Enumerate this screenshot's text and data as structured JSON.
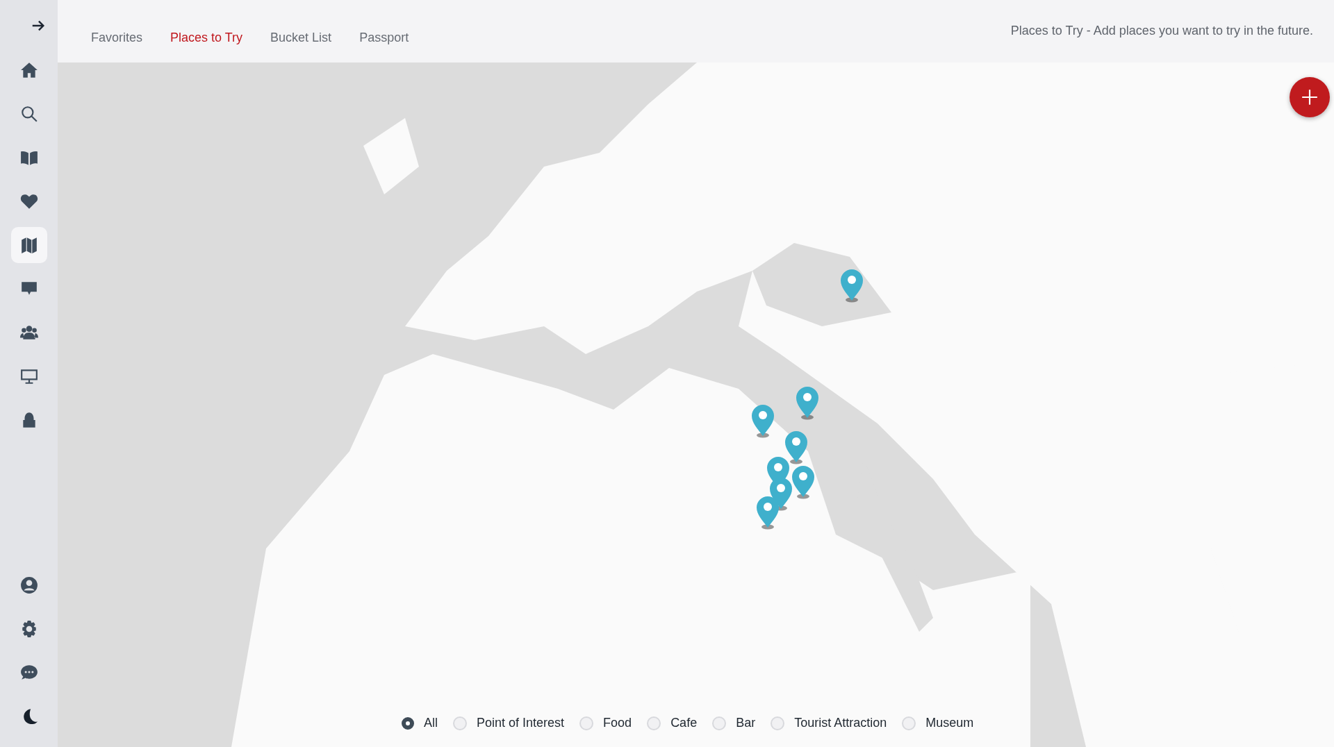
{
  "sidebar": {
    "items": [
      {
        "selected": false
      },
      {
        "selected": false
      },
      {
        "selected": false
      },
      {
        "selected": false
      },
      {
        "selected": true
      },
      {
        "selected": false
      },
      {
        "selected": false
      },
      {
        "selected": false
      },
      {
        "selected": false
      }
    ],
    "bottom_items": [
      {
        "selected": false
      },
      {
        "selected": false
      },
      {
        "selected": false
      },
      {
        "selected": false
      }
    ]
  },
  "tabs": [
    {
      "label": "Favorites",
      "selected": false
    },
    {
      "label": "Places to Try",
      "selected": true
    },
    {
      "label": "Bucket List",
      "selected": false
    },
    {
      "label": "Passport",
      "selected": false
    }
  ],
  "description": "Places to Try - Add places you want to try in the future.",
  "filters": [
    {
      "label": "All",
      "selected": true
    },
    {
      "label": "Point of Interest",
      "selected": false
    },
    {
      "label": "Food",
      "selected": false
    },
    {
      "label": "Cafe",
      "selected": false
    },
    {
      "label": "Bar",
      "selected": false
    },
    {
      "label": "Tourist Attraction",
      "selected": false
    },
    {
      "label": "Museum",
      "selected": false
    }
  ]
}
